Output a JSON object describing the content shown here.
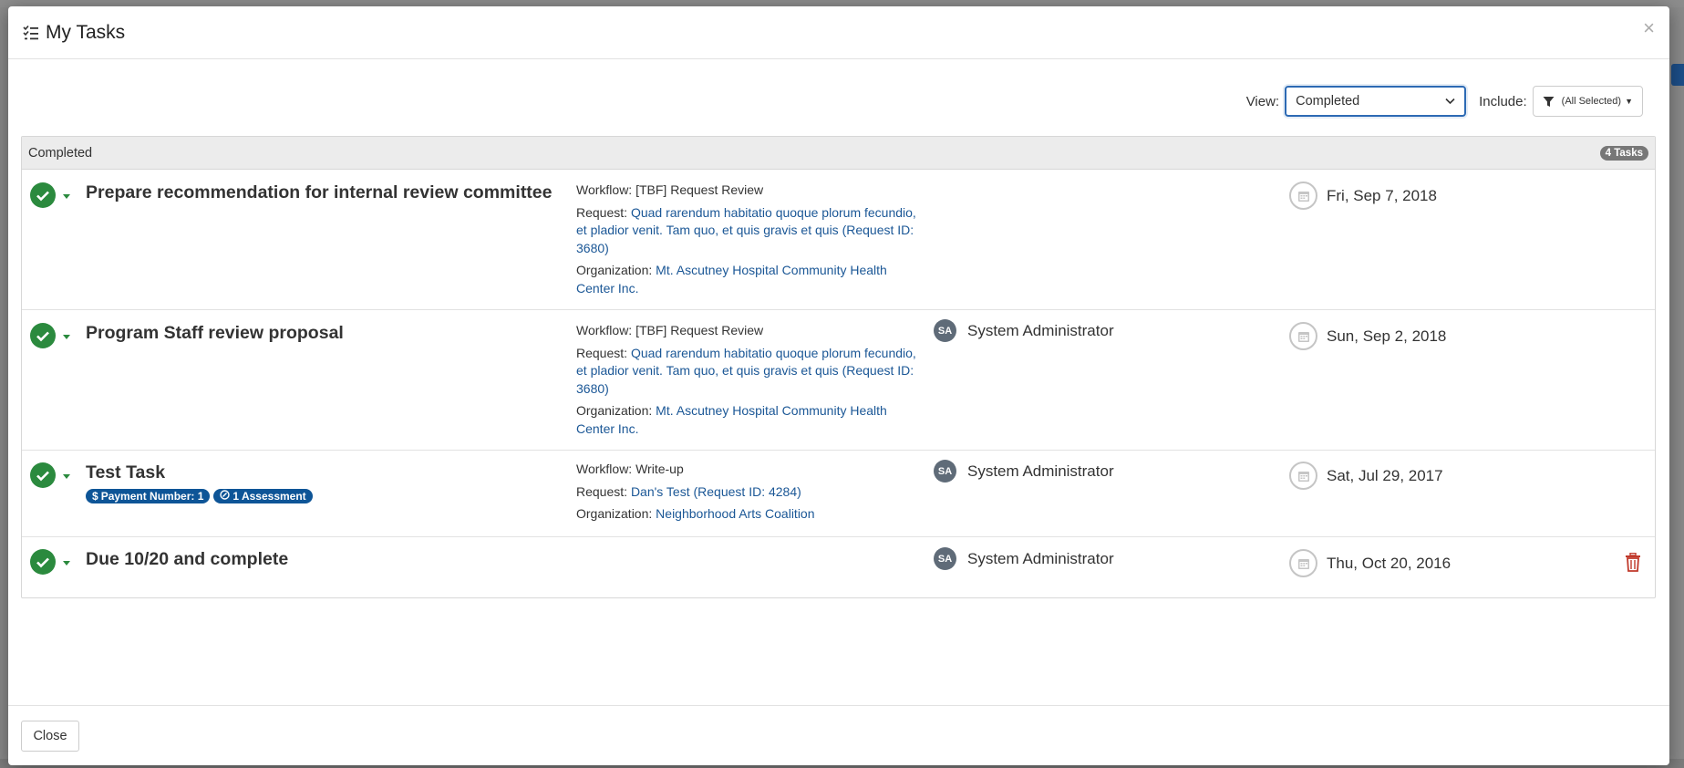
{
  "modal": {
    "title": "My Tasks",
    "close_glyph": "×"
  },
  "toolbar": {
    "view_label": "View:",
    "view_selected": "Completed",
    "include_label": "Include:",
    "include_value": "(All Selected)"
  },
  "panel": {
    "heading": "Completed",
    "count": "4 Tasks"
  },
  "tasks": [
    {
      "title": "Prepare recommendation for internal review committee",
      "workflow_label": "Workflow:",
      "workflow": "[TBF] Request Review",
      "request_label": "Request:",
      "request": "Quad rarendum habitatio quoque plorum fecundio, et pladior venit. Tam quo, et quis gravis et quis (Request ID: 3680)",
      "organization_label": "Organization:",
      "organization": "Mt. Ascutney Hospital Community Health Center Inc.",
      "date": "Fri, Sep 7, 2018"
    },
    {
      "title": "Program Staff review proposal",
      "workflow_label": "Workflow:",
      "workflow": "[TBF] Request Review",
      "request_label": "Request:",
      "request": "Quad rarendum habitatio quoque plorum fecundio, et pladior venit. Tam quo, et quis gravis et quis (Request ID: 3680)",
      "organization_label": "Organization:",
      "organization": "Mt. Ascutney Hospital Community Health Center Inc.",
      "assignee_initials": "SA",
      "assignee": "System Administrator",
      "date": "Sun, Sep 2, 2018"
    },
    {
      "title": "Test Task",
      "badge_payment": "Payment Number: 1",
      "badge_assessment": "1 Assessment",
      "workflow_label": "Workflow:",
      "workflow": "Write-up",
      "request_label": "Request:",
      "request": "Dan's Test (Request ID: 4284)",
      "organization_label": "Organization:",
      "organization": "Neighborhood Arts Coalition",
      "assignee_initials": "SA",
      "assignee": "System Administrator",
      "date": "Sat, Jul 29, 2017"
    },
    {
      "title": "Due 10/20 and complete",
      "assignee_initials": "SA",
      "assignee": "System Administrator",
      "date": "Thu, Oct 20, 2016"
    }
  ],
  "footer": {
    "close_label": "Close"
  },
  "colors": {
    "complete_green": "#2b8a3e",
    "link_blue": "#1b5796",
    "badge_blue": "#0e5597",
    "trash_red": "#c0392b",
    "focus_blue": "#2d6ab4"
  },
  "icons": {
    "title": "tasks-list-icon",
    "check": "check-circle-icon",
    "calendar": "calendar-icon",
    "trash": "trash-icon",
    "filter": "filter-icon"
  }
}
